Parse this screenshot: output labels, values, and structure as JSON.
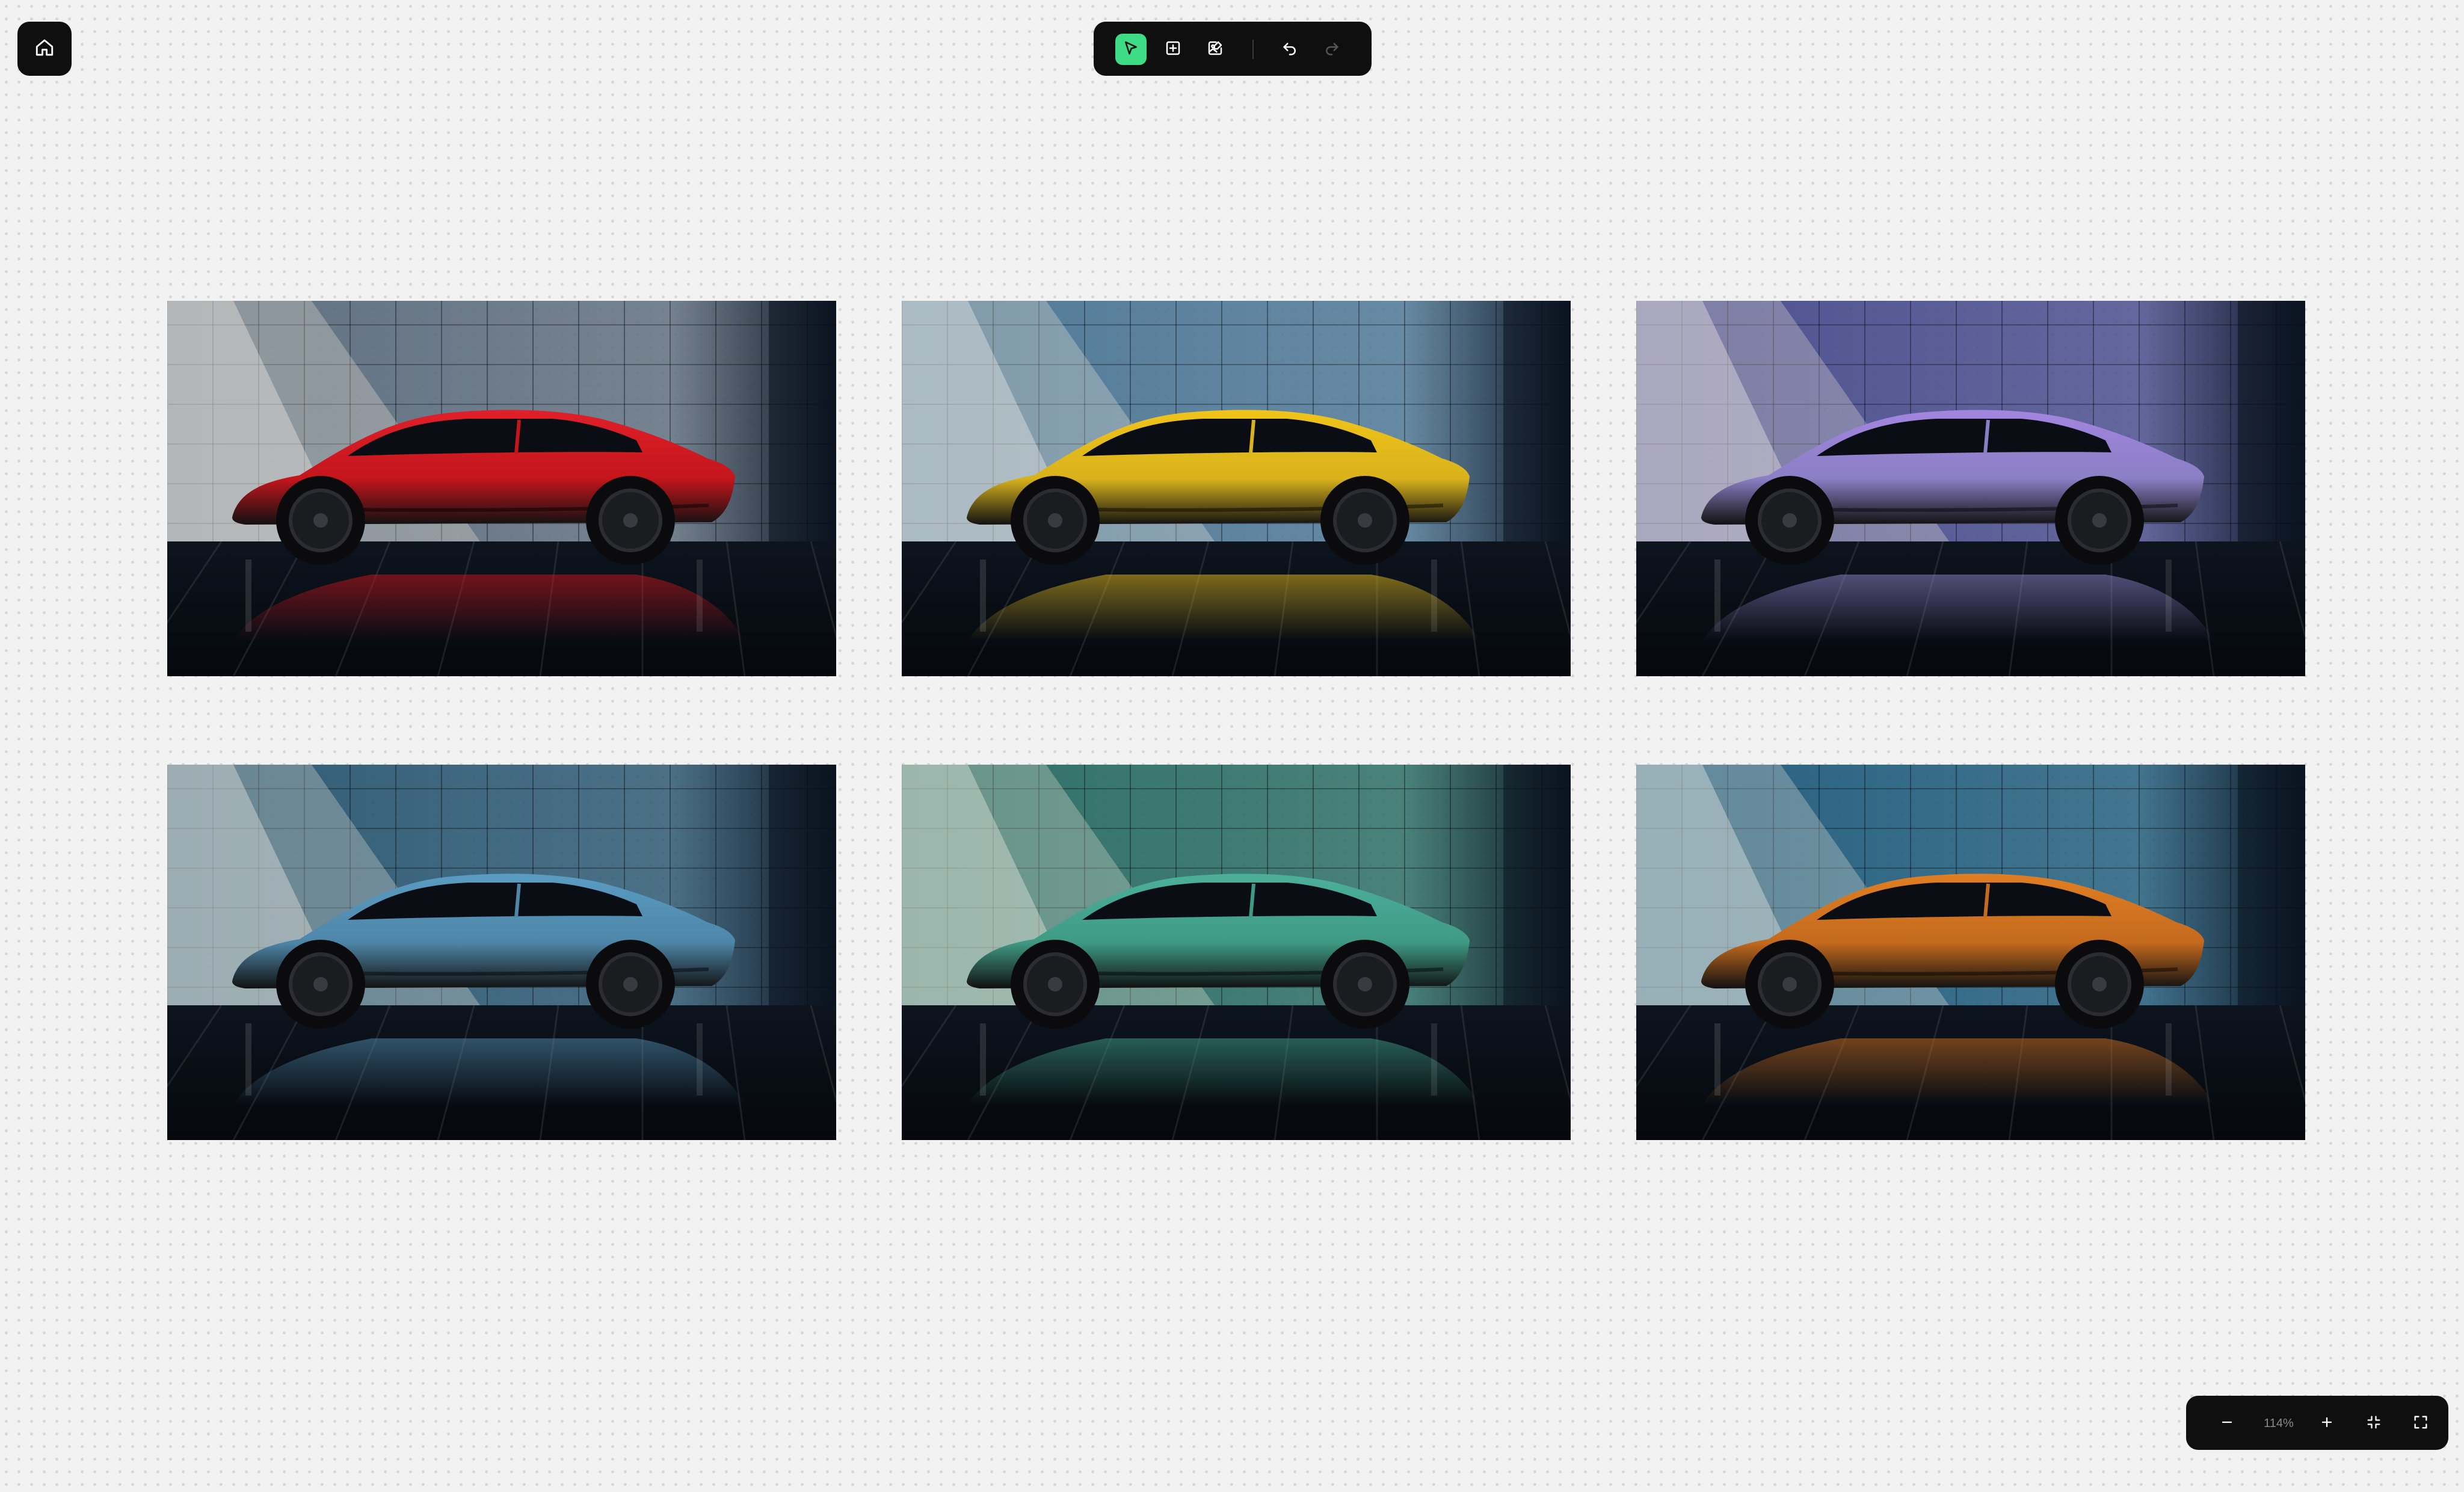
{
  "home": {
    "icon": "home-icon"
  },
  "toolbar": {
    "tools": [
      {
        "name": "select-tool",
        "icon": "cursor-arrow-icon",
        "active": true
      },
      {
        "name": "add-frame-tool",
        "icon": "plus-square-icon",
        "active": false
      },
      {
        "name": "image-tool",
        "icon": "image-edit-icon",
        "active": false
      }
    ],
    "undo": {
      "icon": "undo-icon",
      "enabled": true
    },
    "redo": {
      "icon": "redo-icon",
      "enabled": false
    },
    "active_color": "#3ddc84"
  },
  "canvas": {
    "images": [
      {
        "car_color": "#c4151c",
        "accent": "#e0202a",
        "wall": "#5f6f80"
      },
      {
        "car_color": "#d9b21c",
        "accent": "#f0c419",
        "wall": "#4f7896"
      },
      {
        "car_color": "#8a7fc4",
        "accent": "#a385e0",
        "wall": "#4b4f8e"
      },
      {
        "car_color": "#4e86a8",
        "accent": "#5a9cc2",
        "wall": "#2e5a74"
      },
      {
        "car_color": "#3f9a85",
        "accent": "#4bb09a",
        "wall": "#2c6e66"
      },
      {
        "car_color": "#c46a1e",
        "accent": "#e07e22",
        "wall": "#245f7e"
      }
    ]
  },
  "zoom": {
    "level": "114%",
    "zoom_out_icon": "minus-icon",
    "zoom_in_icon": "plus-icon",
    "fit_icon": "fit-to-screen-icon",
    "fullscreen_icon": "fullscreen-icon"
  }
}
